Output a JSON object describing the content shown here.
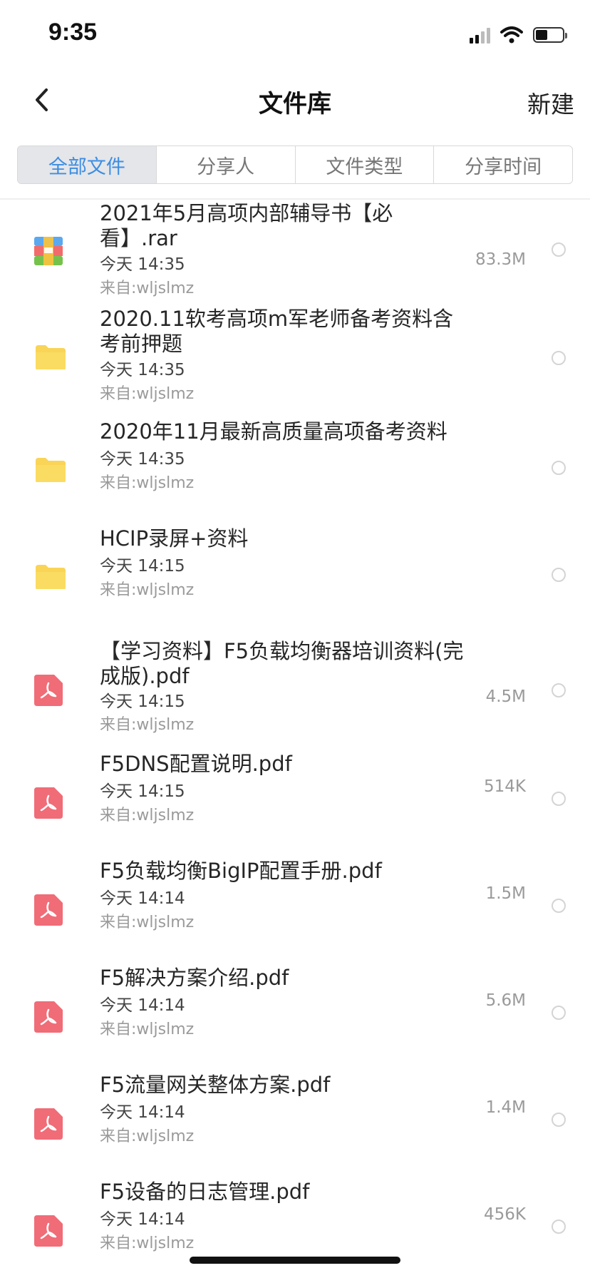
{
  "status": {
    "time": "9:35"
  },
  "nav": {
    "title": "文件库",
    "new_label": "新建"
  },
  "tabs": [
    {
      "label": "全部文件",
      "active": true
    },
    {
      "label": "分享人",
      "active": false
    },
    {
      "label": "文件类型",
      "active": false
    },
    {
      "label": "分享时间",
      "active": false
    }
  ],
  "files": [
    {
      "icon": "archive-icon",
      "name": "2021年5月高项内部辅导书【必看】.rar",
      "time": "今天 14:35",
      "size": "83.3M",
      "from": "来自:wljslmz"
    },
    {
      "icon": "folder-icon",
      "name": "2020.11软考高项m军老师备考资料含考前押题",
      "time": "今天 14:35",
      "size": "",
      "from": "来自:wljslmz"
    },
    {
      "icon": "folder-icon",
      "name": "2020年11月最新高质量高项备考资料",
      "time": "今天 14:35",
      "size": "",
      "from": "来自:wljslmz"
    },
    {
      "icon": "folder-icon",
      "name": "HCIP录屏+资料",
      "time": "今天 14:15",
      "size": "",
      "from": "来自:wljslmz"
    },
    {
      "icon": "pdf-icon",
      "name": "【学习资料】F5负载均衡器培训资料(完成版).pdf",
      "time": "今天 14:15",
      "size": "4.5M",
      "from": "来自:wljslmz"
    },
    {
      "icon": "pdf-icon",
      "name": "F5DNS配置说明.pdf",
      "time": "今天 14:15",
      "size": "514K",
      "from": "来自:wljslmz"
    },
    {
      "icon": "pdf-icon",
      "name": "F5负载均衡BigIP配置手册.pdf",
      "time": "今天 14:14",
      "size": "1.5M",
      "from": "来自:wljslmz"
    },
    {
      "icon": "pdf-icon",
      "name": "F5解决方案介绍.pdf",
      "time": "今天 14:14",
      "size": "5.6M",
      "from": "来自:wljslmz"
    },
    {
      "icon": "pdf-icon",
      "name": "F5流量网关整体方案.pdf",
      "time": "今天 14:14",
      "size": "1.4M",
      "from": "来自:wljslmz"
    },
    {
      "icon": "pdf-icon",
      "name": "F5设备的日志管理.pdf",
      "time": "今天 14:14",
      "size": "456K",
      "from": "来自:wljslmz"
    }
  ]
}
